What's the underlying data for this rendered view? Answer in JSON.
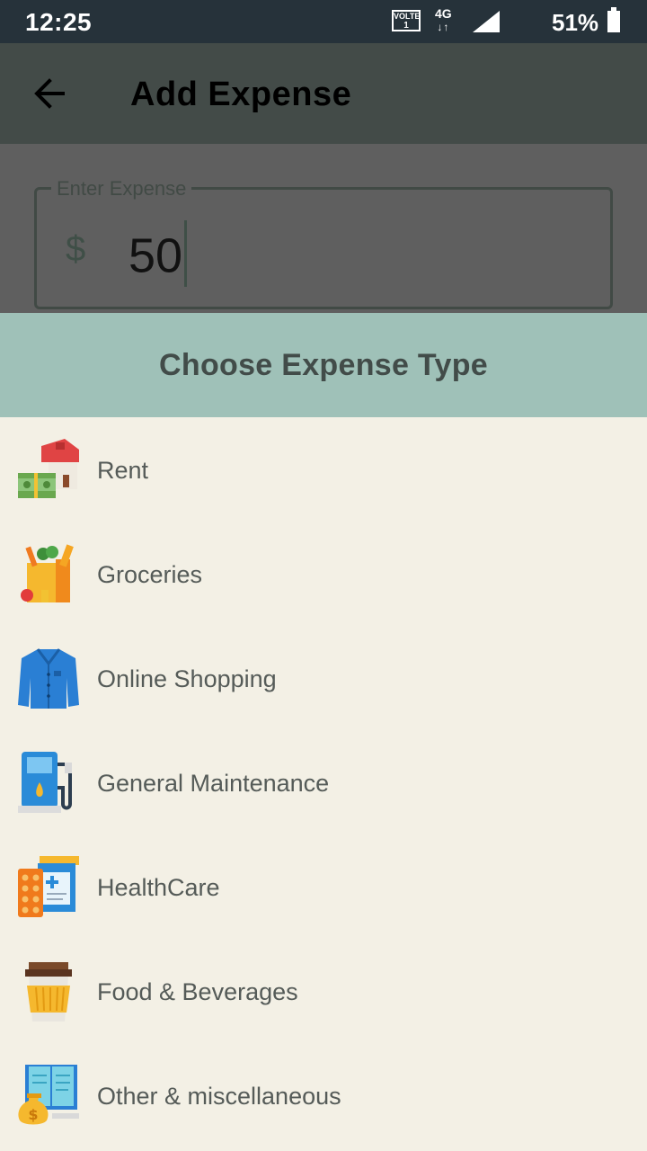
{
  "status_bar": {
    "time": "12:25",
    "volte": "VOLTE",
    "volte_sub": "1",
    "network": "4G",
    "battery": "51%"
  },
  "app_bar": {
    "title": "Add Expense",
    "back_icon": "arrow-back-icon"
  },
  "expense_input": {
    "label": "Enter Expense",
    "currency": "$",
    "value": "50"
  },
  "sheet": {
    "title": "Choose Expense Type",
    "items": [
      {
        "label": "Rent",
        "icon": "house-money-icon"
      },
      {
        "label": "Groceries",
        "icon": "grocery-bag-icon"
      },
      {
        "label": "Online Shopping",
        "icon": "jacket-icon"
      },
      {
        "label": "General Maintenance",
        "icon": "fuel-pump-icon"
      },
      {
        "label": "HealthCare",
        "icon": "medicine-icon"
      },
      {
        "label": "Food & Beverages",
        "icon": "coffee-cup-icon"
      },
      {
        "label": "Other & miscellaneous",
        "icon": "book-money-bag-icon"
      }
    ]
  },
  "colors": {
    "status_bar": "#26323a",
    "app_bar": "#434b48",
    "sheet_header": "#9fc1b8",
    "list_background": "#f3f0e5"
  }
}
